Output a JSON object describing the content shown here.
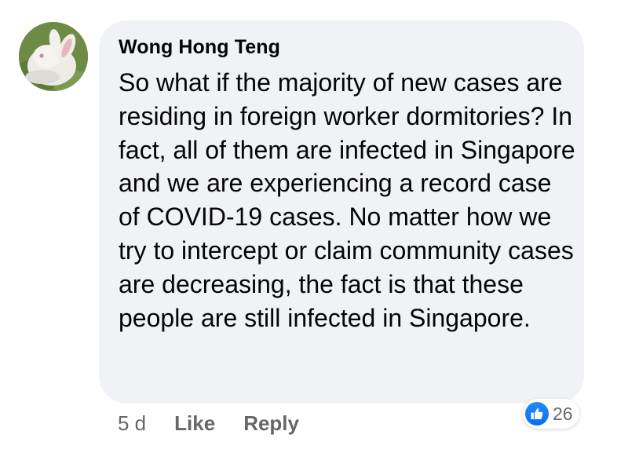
{
  "comment": {
    "author": "Wong Hong Teng",
    "avatar_icon": "rabbit-avatar",
    "text": "So what if the majority of new cases are residing in foreign worker dormitories? In fact, all of them are infected in Singapore and we are experiencing a record case of COVID-19 cases. No matter how we try to intercept or claim community cases are decreasing, the fact is that these people are still infected in Singapore.",
    "timestamp": "5 d",
    "actions": {
      "like_label": "Like",
      "reply_label": "Reply"
    },
    "reactions": {
      "icon": "thumbs-up-icon",
      "count": "26"
    }
  },
  "colors": {
    "bubble_bg": "#f0f2f5",
    "text": "#050505",
    "secondary_text": "#65676b",
    "like_blue": "#1877f2"
  }
}
